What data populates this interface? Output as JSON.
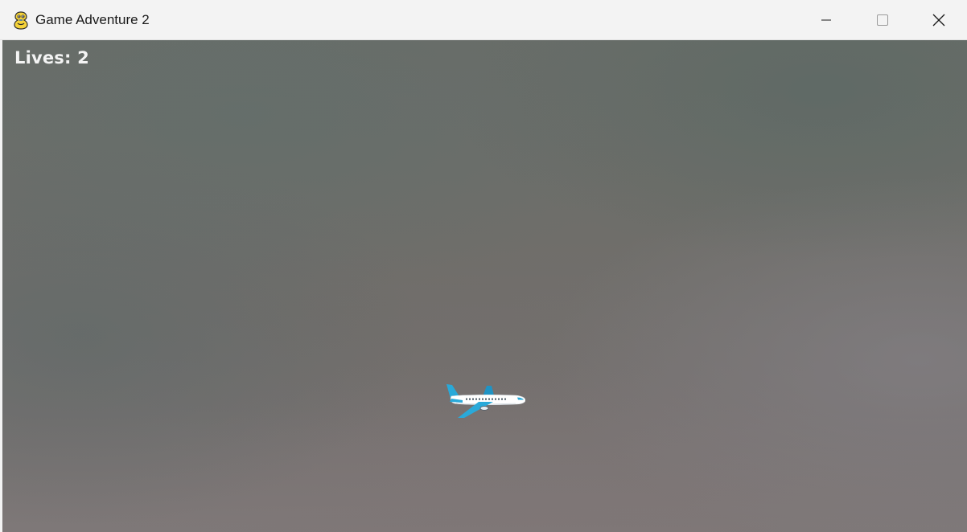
{
  "window": {
    "title": "Game Adventure 2",
    "app_icon": "pygame-snake-icon",
    "controls": {
      "minimize_icon": "minimize-icon",
      "maximize_icon": "maximize-icon",
      "close_icon": "close-icon"
    }
  },
  "game": {
    "hud": {
      "lives_label": "Lives:",
      "lives_value": "2"
    },
    "player": {
      "sprite": "airplane-icon",
      "colors": {
        "body": "#ffffff",
        "wings": "#29a9d9",
        "windows": "#4a5a66"
      }
    },
    "background": {
      "colors": [
        "#6a6d68",
        "#767170",
        "#7e7878"
      ]
    }
  }
}
